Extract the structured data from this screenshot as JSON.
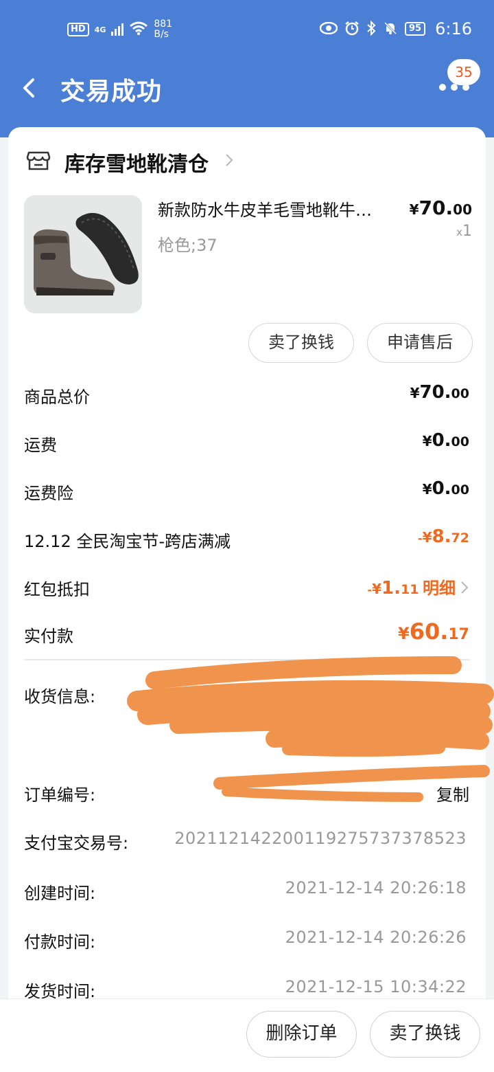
{
  "status_bar": {
    "hd": "HD",
    "network": "4G",
    "speed_value": "881",
    "speed_unit": "B/s",
    "battery": "95",
    "time": "6:16"
  },
  "nav": {
    "title": "交易成功",
    "badge_count": "35"
  },
  "shop": {
    "name": "库存雪地靴清仓"
  },
  "product": {
    "title": "新款防水牛皮羊毛雪地靴牛…",
    "spec": "枪色;37",
    "price_currency": "¥",
    "price_int": "70.",
    "price_dec": "00",
    "qty_x": "x",
    "qty": "1"
  },
  "item_actions": {
    "sell_label": "卖了换钱",
    "aftersale_label": "申请售后"
  },
  "summary": [
    {
      "label": "商品总价",
      "prefix": "",
      "cur": "¥",
      "int": "70.",
      "dec": "00",
      "color": "#111111"
    },
    {
      "label": "运费",
      "prefix": "",
      "cur": "¥",
      "int": "0.",
      "dec": "00",
      "color": "#111111"
    },
    {
      "label": "运费险",
      "prefix": "",
      "cur": "¥",
      "int": "0.",
      "dec": "00",
      "color": "#111111"
    },
    {
      "label": "12.12 全民淘宝节-跨店满减",
      "prefix": "-",
      "cur": "¥",
      "int": "8.",
      "dec": "72",
      "color": "#ef6a1e"
    },
    {
      "label": "红包抵扣",
      "prefix": "-",
      "cur": "¥",
      "int": "1.",
      "dec": "11",
      "color": "#ef6a1e",
      "link": "明细"
    },
    {
      "label": "实付款",
      "prefix": "",
      "cur": "¥",
      "int": "60.",
      "dec": "17",
      "color": "#ef6a1e"
    }
  ],
  "info": {
    "receiver_label": "收货信息:",
    "order_no_label": "订单编号:",
    "copy_label": "复制",
    "alipay_label": "支付宝交易号:",
    "alipay_value": "2021121422001192757373785​23",
    "created_label": "创建时间:",
    "created_value": "2021-12-14 20:26:18",
    "paid_label": "付款时间:",
    "paid_value": "2021-12-14 20:26:26",
    "shipped_label": "发货时间:",
    "shipped_value": "2021-12-15 10:34:22"
  },
  "bottom": {
    "delete_label": "删除订单",
    "sell_label": "卖了换钱"
  },
  "colors": {
    "header_blue": "#4b7fd6",
    "accent_orange": "#ef6a1e",
    "redaction_orange": "#f0944d"
  }
}
